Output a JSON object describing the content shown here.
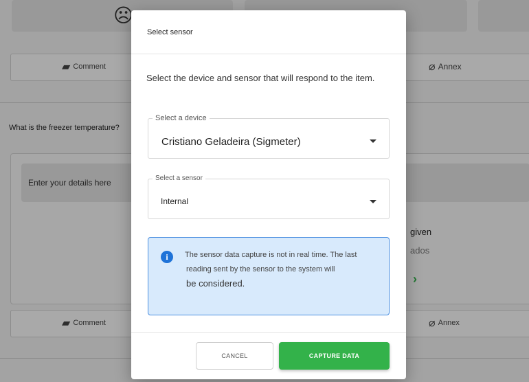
{
  "background": {
    "comment_label": "Comment",
    "annex_label": "Annex",
    "question": "What is the freezer temperature?",
    "details_placeholder": "Enter your details here",
    "partial_given": "given",
    "partial_ados": "ados"
  },
  "modal": {
    "title": "Select sensor",
    "intro": "Select the device and sensor that will respond to the item.",
    "device": {
      "label": "Select a device",
      "value": "Cristiano Geladeira (Sigmeter)"
    },
    "sensor": {
      "label": "Select a sensor",
      "value": "Internal"
    },
    "info": {
      "line1": "The sensor data capture is not in real time. The last",
      "line2": "reading sent by the sensor to the system will",
      "line3": "be considered."
    },
    "cancel_label": "CANCEL",
    "capture_label": "CAPTURE DATA"
  },
  "colors": {
    "primary": "#33b24a",
    "info_bg": "#d8eafc",
    "info_border": "#4a8fe0",
    "info_icon": "#1f73d8"
  }
}
